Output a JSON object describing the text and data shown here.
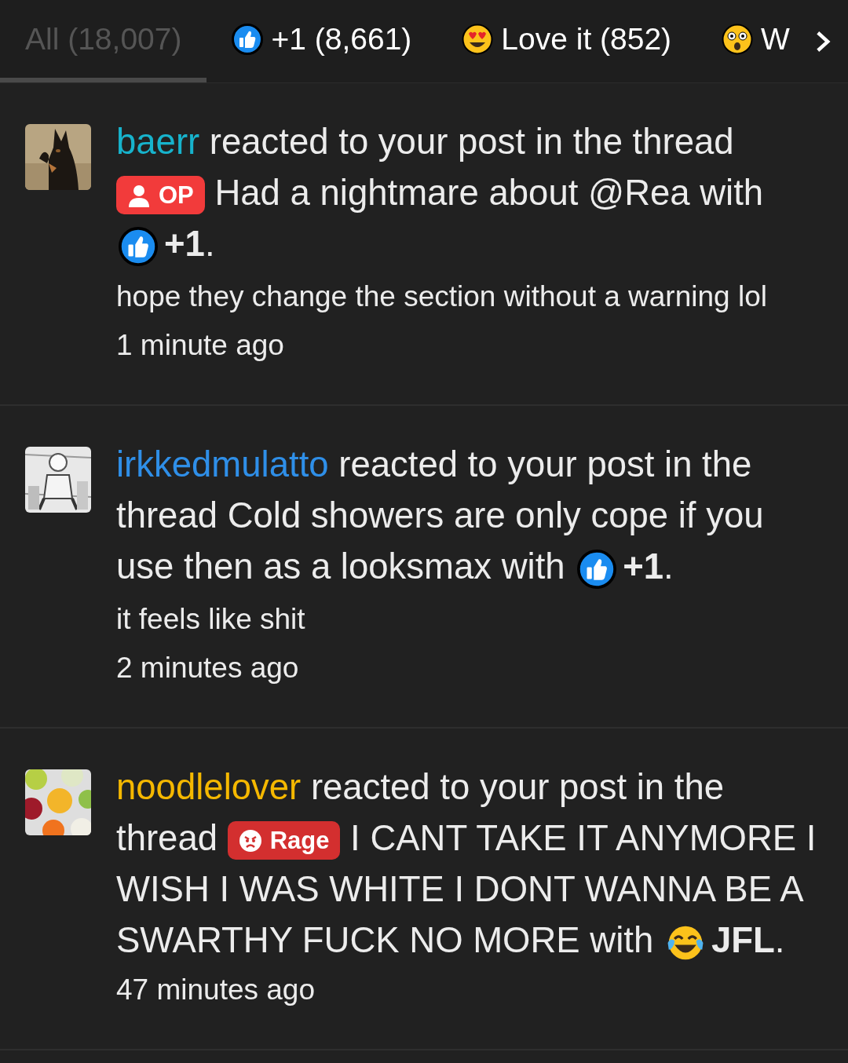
{
  "tabs": [
    {
      "label": "All (18,007)",
      "kind": "all",
      "selected": true
    },
    {
      "label": "+1 (8,661)",
      "kind": "thumbs",
      "selected": false
    },
    {
      "label": "Love it (852)",
      "kind": "love",
      "selected": false
    },
    {
      "label": "W",
      "kind": "wow",
      "selected": false
    }
  ],
  "notifications": [
    {
      "user": "baerr",
      "color": "#17b3cc",
      "action": "reacted to your post in the thread",
      "prefix": {
        "kind": "op",
        "label": "OP"
      },
      "thread_title": "Had a nightmare about @Rea",
      "connector": "with",
      "reaction": {
        "kind": "thumbs",
        "label": "**+1**."
      },
      "snippet": "hope they change the section without a warning lol",
      "time": "1 minute ago"
    },
    {
      "user": "irkkedmulatto",
      "color": "#2f8fe8",
      "action": "reacted to your post in the thread",
      "thread_title": "Cold showers are only cope if you use then as a looksmax",
      "connector": "with",
      "reaction": {
        "kind": "thumbs",
        "label": "**+1**."
      },
      "snippet": "it feels like shit",
      "time": "2 minutes ago"
    },
    {
      "user": "noodlelover",
      "color": "#f5b800",
      "action": "reacted to your post in the thread",
      "prefix": {
        "kind": "rage",
        "label": "Rage"
      },
      "thread_title": "I CANT TAKE IT ANYMORE I WISH I WAS WHITE I DONT WANNA BE A SWARTHY FUCK NO MORE",
      "connector": "with",
      "reaction": {
        "kind": "laugh",
        "label": "**JFL**."
      },
      "time": "47 minutes ago"
    }
  ]
}
